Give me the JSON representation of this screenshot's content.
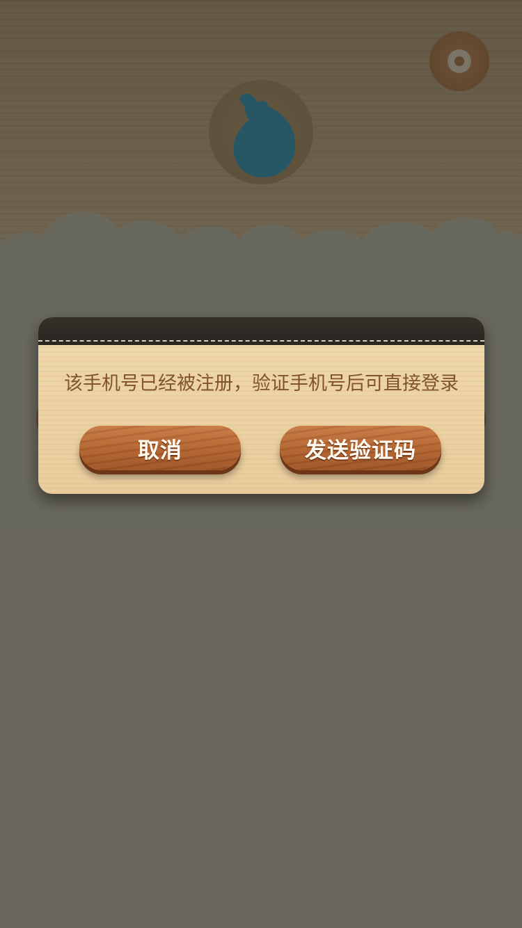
{
  "dialog": {
    "message": "该手机号已经被注册，验证手机号后可直接登录",
    "cancel_label": "取消",
    "send_code_label": "发送验证码"
  },
  "icons": {
    "avatar": "bird-silhouette-icon",
    "settings": "settings-icon"
  },
  "colors": {
    "dialog_wood": "#ecd3a4",
    "dialog_header": "#2e2924",
    "button_wood": "#b0622f",
    "message_text": "#80532d",
    "avatar_accent": "#1a9ad0"
  }
}
